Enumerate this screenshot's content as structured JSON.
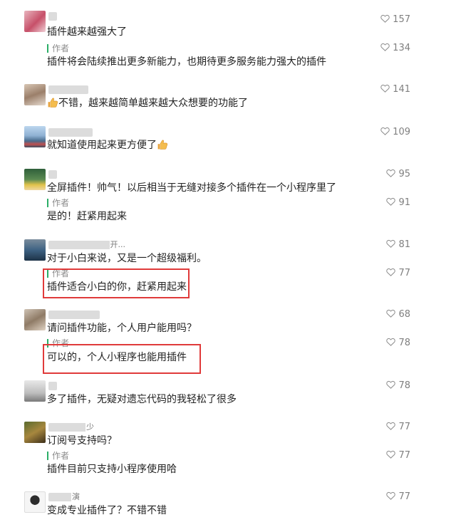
{
  "comments": [
    {
      "text": "插件越来越强大了",
      "likes": "157",
      "author_reply": {
        "label": "作者",
        "text": "插件将会陆续推出更多新能力，也期待更多服务能力强大的插件",
        "likes": "134"
      }
    },
    {
      "text_prefix": "",
      "text": "不错，越来越简单越来越大众想要的功能了",
      "likes": "141"
    },
    {
      "text": "就知道使用起来更方便了",
      "likes": "109"
    },
    {
      "text": "全屏插件！帅气！以后相当于无缝对接多个插件在一个小程序里了",
      "likes": "95",
      "author_reply": {
        "label": "作者",
        "text": "是的！赶紧用起来",
        "likes": "91"
      }
    },
    {
      "name_suffix": "开...",
      "text": "对于小白来说，又是一个超级福利。",
      "likes": "81",
      "author_reply": {
        "label": "作者",
        "text": "插件适合小白的你，赶紧用起来",
        "likes": "77"
      }
    },
    {
      "text": "请问插件功能，个人用户能用吗？",
      "likes": "68",
      "author_reply": {
        "label": "作者",
        "text": "可以的，个人小程序也能用插件",
        "likes": "78"
      }
    },
    {
      "text": "多了插件，无疑对遗忘代码的我轻松了很多",
      "likes": "78"
    },
    {
      "name_suffix": "少",
      "text": "订阅号支持吗？",
      "likes": "77",
      "author_reply": {
        "label": "作者",
        "text": "插件目前只支持小程序使用哈",
        "likes": "77"
      }
    },
    {
      "name_suffix": "演",
      "text": "变成专业插件了？不错不错",
      "likes": "77"
    }
  ],
  "colors": {
    "highlight": "#e03a3a",
    "reply_bar": "#2aae67"
  }
}
